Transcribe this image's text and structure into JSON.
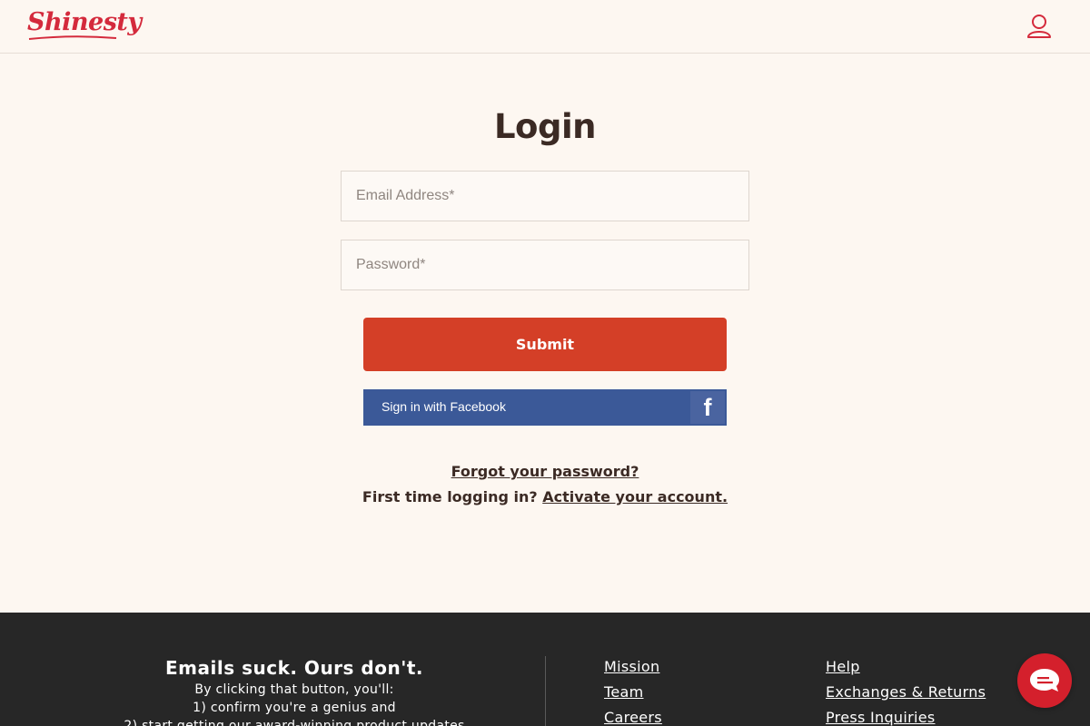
{
  "brand": {
    "logo_text": "Shinesty",
    "accent": "#d42a3c"
  },
  "header": {
    "account_icon": "user-account-icon"
  },
  "login": {
    "title": "Login",
    "email_placeholder": "Email Address*",
    "password_placeholder": "Password*",
    "submit_label": "Submit",
    "facebook_label": "Sign in with Facebook",
    "facebook_icon": "facebook-icon",
    "forgot_label": "Forgot your password?",
    "first_time_text": "First time logging in?",
    "activate_label": "Activate your account."
  },
  "colors": {
    "submit_bg": "#d43f27",
    "facebook_bg": "#3b5998",
    "footer_bg": "#272727"
  },
  "footer": {
    "heading": "Emails suck. Ours don't.",
    "line1": "By clicking that button, you'll:",
    "line2": "1) confirm you're a genius and",
    "line3": "2) start getting our award-winning product updates",
    "links_col1": [
      "Mission",
      "Team",
      "Careers"
    ],
    "links_col2": [
      "Help",
      "Exchanges & Returns",
      "Press Inquiries"
    ]
  },
  "chat": {
    "icon": "chat-icon"
  }
}
